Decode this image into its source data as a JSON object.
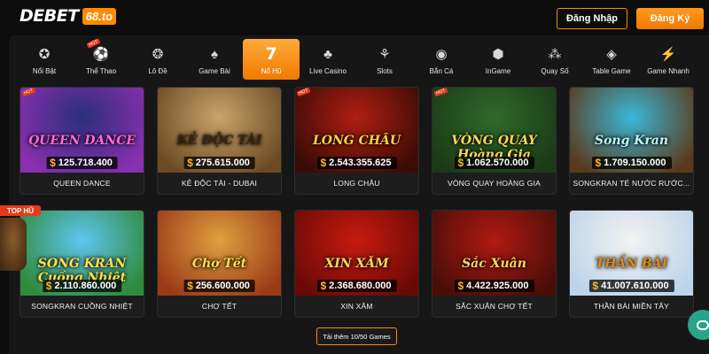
{
  "header": {
    "logo_text": "DEBET",
    "logo_domain": "68.to",
    "login_label": "Đăng Nhập",
    "register_label": "Đăng Ký"
  },
  "nav": {
    "items": [
      {
        "label": "Nổi Bật",
        "icon": "medal-icon",
        "glyph": "✪"
      },
      {
        "label": "Thể Thao",
        "icon": "soccer-ball-icon",
        "glyph": "⚽",
        "hot": "HOT"
      },
      {
        "label": "Lô Đề",
        "icon": "lottery-wheel-icon",
        "glyph": "❂"
      },
      {
        "label": "Game Bài",
        "icon": "playing-cards-icon",
        "glyph": "♠"
      },
      {
        "label": "Nổ Hũ",
        "icon": "slot-seven-icon",
        "glyph": "7",
        "active": true
      },
      {
        "label": "Live Casino",
        "icon": "casino-chip-icon",
        "glyph": "♣"
      },
      {
        "label": "Slots",
        "icon": "cherries-icon",
        "glyph": "⚘"
      },
      {
        "label": "Bắn Cá",
        "icon": "fish-icon",
        "glyph": "◉"
      },
      {
        "label": "InGame",
        "icon": "dice-icon",
        "glyph": "⬢"
      },
      {
        "label": "Quay Số",
        "icon": "balls-icon",
        "glyph": "⁂"
      },
      {
        "label": "Table Game",
        "icon": "table-chip-icon",
        "glyph": "◈"
      },
      {
        "label": "Game Nhanh",
        "icon": "lightning-icon",
        "glyph": "⚡"
      }
    ]
  },
  "games": [
    {
      "name": "QUEEN DANCE",
      "art_title": "QUEEN DANCE",
      "jackpot": "125.718.400",
      "hot": "HOT",
      "bg1": "#2a2f7a",
      "bg2": "#8a2fb0",
      "title_color": "#ff6ad8"
    },
    {
      "name": "KẺ ĐỘC TÀI - DUBAI",
      "art_title": "KẺ ĐỘC TÀI",
      "jackpot": "275.615.000",
      "hot": "",
      "bg1": "#c9a46a",
      "bg2": "#6b4a24",
      "title_color": "#3a2410"
    },
    {
      "name": "LONG CHÂU",
      "art_title": "LONG CHÂU",
      "jackpot": "2.543.355.625",
      "hot": "HOT",
      "bg1": "#b01e12",
      "bg2": "#3a0c06",
      "title_color": "#ffd24a"
    },
    {
      "name": "VÒNG QUAY HOÀNG GIA",
      "art_title": "VÒNG QUAY Hoàng Gia",
      "jackpot": "1.062.570.000",
      "hot": "HOT",
      "bg1": "#2f6a2a",
      "bg2": "#1c3a18",
      "title_color": "#ffd75a"
    },
    {
      "name": "SONGKRAN TÉ NƯỚC RƯỚC...",
      "art_title": "Song Kran",
      "jackpot": "1.709.150.000",
      "hot": "",
      "bg1": "#3ab8d8",
      "bg2": "#5a3a1c",
      "title_color": "#bff6ff"
    },
    {
      "name": "SONGKRAN CUỒNG NHIỆT",
      "art_title": "SONG KRAN Cuồng Nhiệt",
      "jackpot": "2.110.860.000",
      "hot": "",
      "bg1": "#5fc6f0",
      "bg2": "#2f8a3a",
      "title_color": "#ffe14a"
    },
    {
      "name": "CHỢ TẾT",
      "art_title": "Chợ Tết",
      "jackpot": "256.600.000",
      "hot": "",
      "bg1": "#e0a040",
      "bg2": "#9a3a18",
      "title_color": "#ffe04a"
    },
    {
      "name": "XIN XĂM",
      "art_title": "XIN XĂM",
      "jackpot": "2.368.680.000",
      "hot": "",
      "bg1": "#c81a10",
      "bg2": "#6a0a06",
      "title_color": "#ffd75a"
    },
    {
      "name": "SẮC XUÂN CHỢ TẾT",
      "art_title": "Sắc Xuân",
      "jackpot": "4.422.925.000",
      "hot": "",
      "bg1": "#b01a12",
      "bg2": "#4a0e08",
      "title_color": "#ffd75a"
    },
    {
      "name": "THẦN BÀI MIỀN TÂY",
      "art_title": "THẦN BÀI",
      "jackpot": "41.007.610.000",
      "hot": "",
      "bg1": "#f2f2f2",
      "bg2": "#bcd4ea",
      "title_color": "#e08a10"
    }
  ],
  "top_hu_label": "TOP HŨ",
  "load_more_label": "Tải thêm 10/50 Games",
  "currency_symbol": "$",
  "colors": {
    "accent": "#ff8a00",
    "background": "#0c0c0c",
    "panel": "#161616"
  }
}
